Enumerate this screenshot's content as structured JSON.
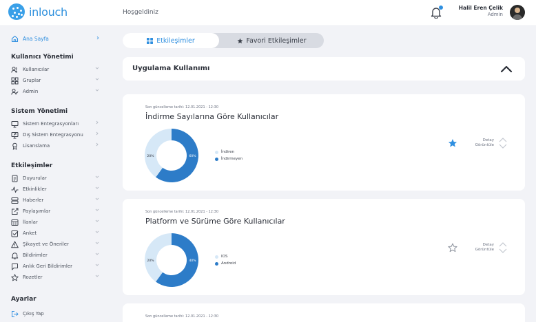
{
  "app": {
    "logo_text": "inlouch",
    "welcome": "Hoşgeldiniz"
  },
  "user": {
    "name": "Halil Eren Çelik",
    "role": "Admin"
  },
  "sidebar": {
    "home": {
      "label": "Ana Sayfa",
      "icon": "home-icon"
    },
    "sections": [
      {
        "title": "Kullanıcı Yönetimi",
        "items": [
          {
            "label": "Kullanıcılar",
            "icon": "users-icon"
          },
          {
            "label": "Gruplar",
            "icon": "grid-icon"
          },
          {
            "label": "Admin",
            "icon": "admin-user-icon"
          }
        ]
      },
      {
        "title": "Sistem Yönetimi",
        "items": [
          {
            "label": "Sistem Entegrasyonları",
            "icon": "monitor-icon"
          },
          {
            "label": "Dış Sistem Entegrasyonu",
            "icon": "external-monitor-icon"
          },
          {
            "label": "Lisanslama",
            "icon": "license-icon"
          }
        ]
      },
      {
        "title": "Etkileşimler",
        "items": [
          {
            "label": "Duyurular",
            "icon": "document-icon"
          },
          {
            "label": "Etkinlikler",
            "icon": "activity-icon"
          },
          {
            "label": "Haberler",
            "icon": "news-icon"
          },
          {
            "label": "Paylaşımlar",
            "icon": "share-icon"
          },
          {
            "label": "İlanlar",
            "icon": "listing-icon"
          },
          {
            "label": "Anket",
            "icon": "checkbox-icon"
          },
          {
            "label": "Şikayet ve Öneriler",
            "icon": "warning-icon"
          },
          {
            "label": "Bildirimler",
            "icon": "bell-icon"
          },
          {
            "label": "Anlık Geri Bildirimler",
            "icon": "chat-icon"
          },
          {
            "label": "Rozetler",
            "icon": "star-outline-icon"
          }
        ]
      },
      {
        "title": "Ayarlar",
        "items": [
          {
            "label": "Çıkış Yap",
            "icon": "logout-icon"
          }
        ]
      }
    ]
  },
  "tabs": [
    {
      "label": "Etkileşimler",
      "icon": "grid-icon",
      "active": true
    },
    {
      "label": "Favori Etkileşimler",
      "icon": "star-icon",
      "active": false
    }
  ],
  "section": {
    "title": "Uygulama Kullanımı"
  },
  "colors": {
    "accent": "#2f8fe0",
    "donut_light": "#d6e8f7",
    "donut_dark": "#2d7cc8",
    "background": "#f2f3f7"
  },
  "cards": [
    {
      "updated": "Son güncelleme tarihi: 12.01.2021 - 12:30",
      "title": "İndirme Sayılarına Göre Kullanıcılar",
      "favorite": true,
      "detail_line1": "Detay",
      "detail_line2": "Görüntüle",
      "chart_data": {
        "type": "pie",
        "categories": [
          "İndiren",
          "İndirmeyen"
        ],
        "values": [
          40,
          60
        ],
        "data_labels": [
          "20%",
          "60%"
        ]
      }
    },
    {
      "updated": "Son güncelleme tarihi: 12.01.2021 - 12:30",
      "title": "Platform ve Sürüme Göre Kullanıcılar",
      "favorite": false,
      "detail_line1": "Detay",
      "detail_line2": "Görüntüle",
      "chart_data": {
        "type": "pie",
        "categories": [
          "IOS",
          "Android"
        ],
        "values": [
          40,
          60
        ],
        "data_labels": [
          "20%",
          "40%"
        ]
      }
    },
    {
      "updated": "Son güncelleme tarihi: 12.01.2021 - 12:30"
    }
  ]
}
